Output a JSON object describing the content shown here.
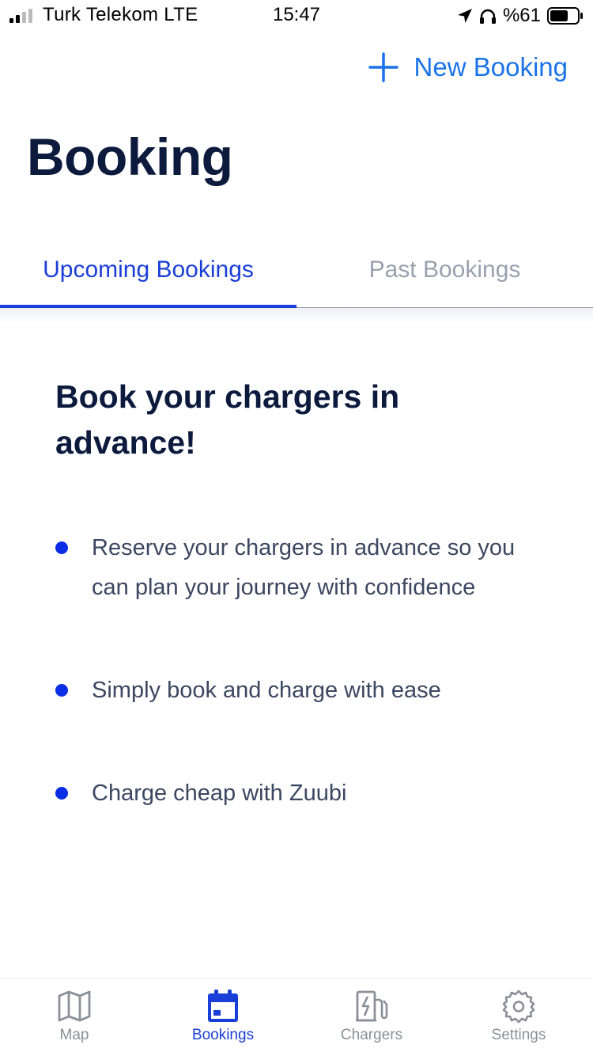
{
  "status_bar": {
    "carrier": "Turk Telekom LTE",
    "time": "15:47",
    "battery": "%61"
  },
  "header": {
    "new_booking_label": "New Booking",
    "title": "Booking"
  },
  "tabs": [
    {
      "label": "Upcoming Bookings",
      "active": true
    },
    {
      "label": "Past Bookings",
      "active": false
    }
  ],
  "promo": {
    "title": "Book your chargers in advance!",
    "features": [
      "Reserve your chargers in advance so you can plan your journey with confidence",
      "Simply book and charge with ease",
      "Charge cheap with Zuubi"
    ]
  },
  "tabbar": [
    {
      "label": "Map",
      "icon": "map-icon",
      "active": false
    },
    {
      "label": "Bookings",
      "icon": "calendar-icon",
      "active": true
    },
    {
      "label": "Chargers",
      "icon": "charger-icon",
      "active": false
    },
    {
      "label": "Settings",
      "icon": "gear-icon",
      "active": false
    }
  ],
  "colors": {
    "accent": "#1a3ed8",
    "link": "#1a73e8",
    "title": "#0b1a3d",
    "inactive": "#8a8f98",
    "bullet": "#0a2ee6"
  }
}
